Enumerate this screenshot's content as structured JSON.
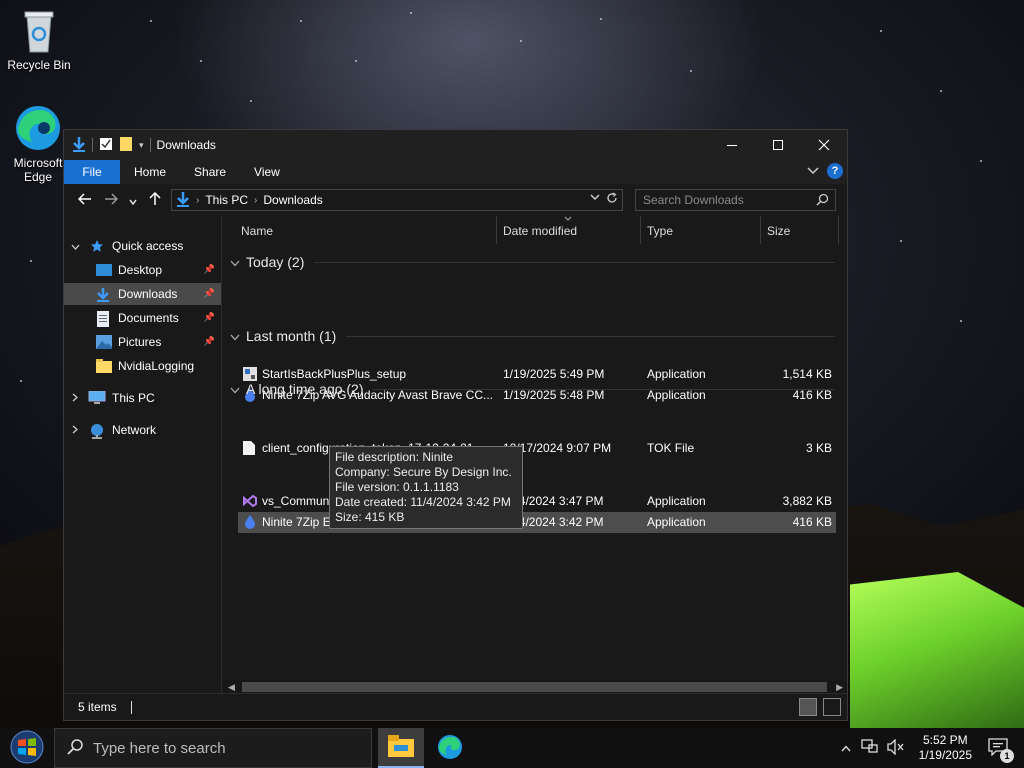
{
  "desktop": {
    "icons": [
      {
        "label": "Recycle Bin"
      },
      {
        "label": "Microsoft Edge"
      }
    ]
  },
  "window": {
    "title": "Downloads",
    "ribbon_tabs": [
      "File",
      "Home",
      "Share",
      "View"
    ],
    "breadcrumb": [
      "This PC",
      "Downloads"
    ],
    "search_placeholder": "Search Downloads",
    "nav": {
      "quick_access": "Quick access",
      "items": [
        {
          "label": "Desktop",
          "pinned": true
        },
        {
          "label": "Downloads",
          "pinned": true,
          "selected": true
        },
        {
          "label": "Documents",
          "pinned": true
        },
        {
          "label": "Pictures",
          "pinned": true
        },
        {
          "label": "NvidiaLogging",
          "pinned": false
        }
      ],
      "this_pc": "This PC",
      "network": "Network"
    },
    "columns": [
      "Name",
      "Date modified",
      "Type",
      "Size"
    ],
    "groups": [
      {
        "title": "Today (2)"
      },
      {
        "title": "Last month (1)"
      },
      {
        "title": "A long time ago (2)"
      }
    ],
    "files": [
      {
        "name": "StartIsBackPlusPlus_setup",
        "date": "1/19/2025 5:49 PM",
        "type": "Application",
        "size": "1,514 KB"
      },
      {
        "name": "Ninite 7Zip AVG Audacity Avast Brave CC...",
        "date": "1/19/2025 5:48 PM",
        "type": "Application",
        "size": "416 KB"
      },
      {
        "name": "client_configuration_token_17-12-24-21-...",
        "date": "12/17/2024 9:07 PM",
        "type": "TOK File",
        "size": "3 KB"
      },
      {
        "name": "vs_Community",
        "date": "11/4/2024 3:47 PM",
        "type": "Application",
        "size": "3,882 KB"
      },
      {
        "name": "Ninite 7Zip Everything Firefox Installer",
        "date": "11/4/2024 3:42 PM",
        "type": "Application",
        "size": "416 KB"
      }
    ],
    "tooltip": [
      "File description: Ninite",
      "Company: Secure By Design Inc.",
      "File version: 0.1.1.1183",
      "Date created: 11/4/2024 3:42 PM",
      "Size: 415 KB"
    ],
    "status": "5 items"
  },
  "taskbar": {
    "search_placeholder": "Type here to search",
    "time": "5:52 PM",
    "date": "1/19/2025",
    "notification_count": "1"
  }
}
